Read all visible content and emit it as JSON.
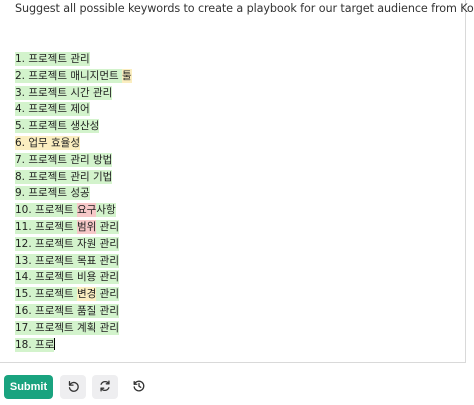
{
  "prompt": "Suggest all possible keywords to create a playbook for our target audience from Korea.",
  "lines": [
    {
      "segs": [
        {
          "t": "1. 프로젝트 관리",
          "c": "g"
        }
      ]
    },
    {
      "segs": [
        {
          "t": "2. 프로젝트 매니지먼트 ",
          "c": "g"
        },
        {
          "t": "툴",
          "c": "y"
        }
      ]
    },
    {
      "segs": [
        {
          "t": "3. 프로젝트 시간 관리",
          "c": "g"
        }
      ]
    },
    {
      "segs": [
        {
          "t": "4. 프로젝트 제어",
          "c": "g"
        }
      ]
    },
    {
      "segs": [
        {
          "t": "5. 프로젝트 생산성",
          "c": "g"
        }
      ]
    },
    {
      "segs": [
        {
          "t": "6. 업무 효율성",
          "c": "y"
        }
      ]
    },
    {
      "segs": [
        {
          "t": "7. 프로젝트 관리 방법",
          "c": "g"
        }
      ]
    },
    {
      "segs": [
        {
          "t": "8. 프로젝트 관리 기법",
          "c": "g"
        }
      ]
    },
    {
      "segs": [
        {
          "t": "9. 프로젝트 성공",
          "c": "g"
        }
      ]
    },
    {
      "segs": [
        {
          "t": "10. 프로젝트 ",
          "c": "g"
        },
        {
          "t": "요구",
          "c": "r"
        },
        {
          "t": "사항",
          "c": "g"
        }
      ]
    },
    {
      "segs": [
        {
          "t": "11. 프로젝트 ",
          "c": "g"
        },
        {
          "t": "범위",
          "c": "r"
        },
        {
          "t": " 관리",
          "c": "g"
        }
      ]
    },
    {
      "segs": [
        {
          "t": "12. 프로젝트 자원 관리",
          "c": "g"
        }
      ]
    },
    {
      "segs": [
        {
          "t": "13. 프로젝트 목표 관리",
          "c": "g"
        }
      ]
    },
    {
      "segs": [
        {
          "t": "14. 프로젝트 비용 관리",
          "c": "g"
        }
      ]
    },
    {
      "segs": [
        {
          "t": "15. 프로젝트 ",
          "c": "g"
        },
        {
          "t": "변경",
          "c": "y"
        },
        {
          "t": " 관리",
          "c": "g"
        }
      ]
    },
    {
      "segs": [
        {
          "t": "16. 프로젝트 품질 관리",
          "c": "g"
        }
      ]
    },
    {
      "segs": [
        {
          "t": "17. 프로젝트 계획 관리",
          "c": "g"
        }
      ]
    },
    {
      "segs": [
        {
          "t": "18. 프로",
          "c": "g"
        }
      ],
      "caret": true
    }
  ],
  "toolbar": {
    "submit_label": "Submit",
    "undo_icon": "undo-icon",
    "regenerate_icon": "regenerate-icon",
    "history_icon": "history-icon"
  },
  "colors": {
    "submit": "#19a37f",
    "highlight_green": "#d3f3cc",
    "highlight_yellow": "#fbeec0",
    "highlight_red": "#f6c8c8"
  }
}
